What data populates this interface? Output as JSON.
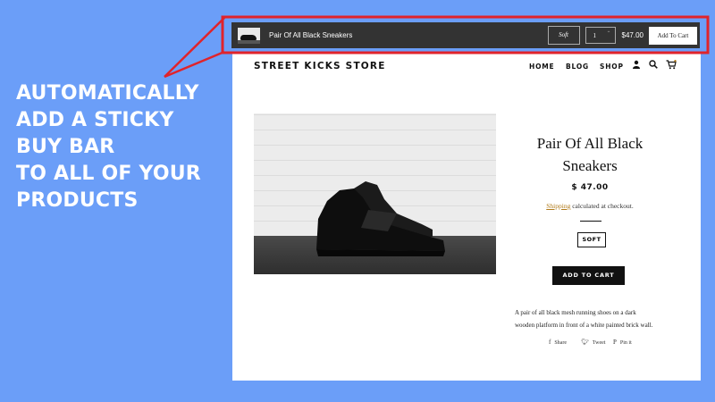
{
  "promo": {
    "lines": [
      "AUTOMATICALLY",
      "ADD A STICKY",
      "BUY BAR",
      "TO ALL OF YOUR",
      "PRODUCTS"
    ]
  },
  "sticky_bar": {
    "product_title": "Pair Of All Black Sneakers",
    "variant": "Soft",
    "quantity": "1",
    "price": "$47.00",
    "add_label": "Add To Cart"
  },
  "store": {
    "name": "STREET KICKS STORE",
    "nav": [
      "HOME",
      "BLOG",
      "SHOP"
    ],
    "icons": [
      "account-icon",
      "search-icon",
      "cart-icon"
    ]
  },
  "product": {
    "title_line1": "Pair Of All Black",
    "title_line2": "Sneakers",
    "price": "$ 47.00",
    "shipping_link": "Shipping",
    "shipping_text": "calculated at checkout.",
    "variant": "SOFT",
    "add_to_cart": "ADD TO CART",
    "description_line1": "A pair of all black mesh running shoes on a dark",
    "description_line2": "wooden platform in front of a white painted brick wall.",
    "share": [
      "Share",
      "Tweet",
      "Pin it"
    ]
  },
  "colors": {
    "background": "#6b9ef8",
    "callout": "#e0232b",
    "sticky_bar": "#333333",
    "shipping_link": "#b07a1a"
  }
}
